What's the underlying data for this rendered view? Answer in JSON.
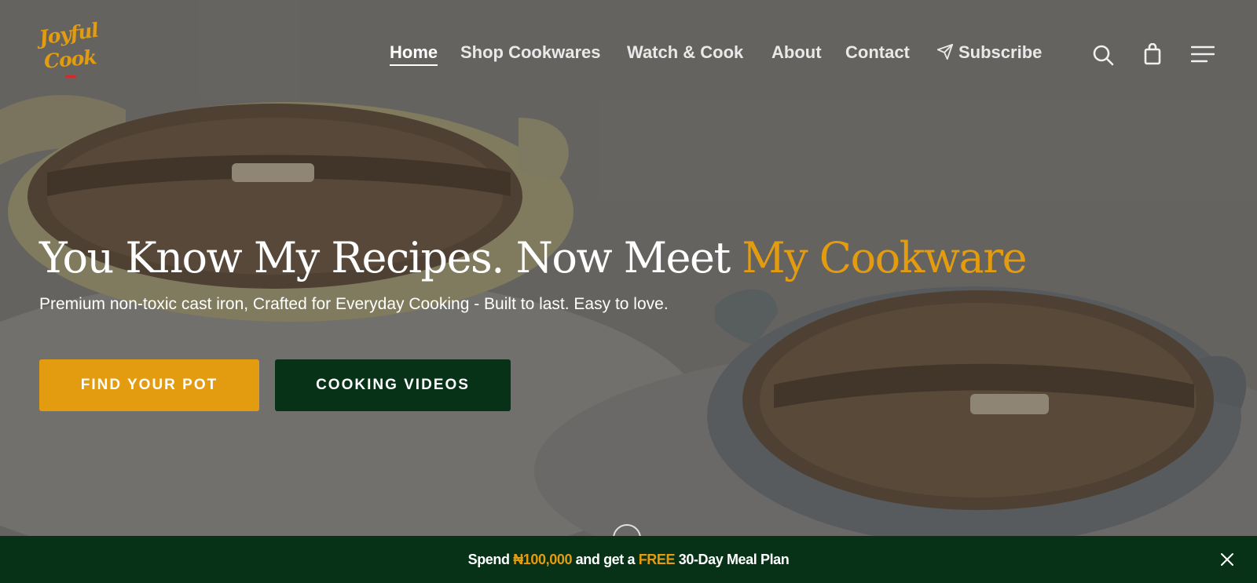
{
  "brand": {
    "logo_line1": "Joyful",
    "logo_line2": "Cook"
  },
  "nav": {
    "items": [
      {
        "label": "Home",
        "active": true
      },
      {
        "label": "Shop Cookwares"
      },
      {
        "label": "Watch & Cook"
      },
      {
        "label": "About"
      },
      {
        "label": "Contact"
      },
      {
        "label": "Subscribe",
        "icon": "paper-plane-icon"
      }
    ],
    "icons": [
      "search-icon",
      "shopping-bag-icon",
      "menu-icon"
    ]
  },
  "hero": {
    "headline_main": "You Know My Recipes. Now Meet ",
    "headline_accent": "My Cookware",
    "subheading": "Premium non-toxic cast iron, Crafted for Everyday Cooking - Built to last. Easy to love.",
    "primary_cta": "FIND YOUR POT",
    "secondary_cta": "COOKING VIDEOS"
  },
  "promo": {
    "prefix": "Spend ",
    "amount": "₦100,000",
    "middle": " and get a ",
    "free": "FREE",
    "suffix": " 30-Day Meal Plan"
  },
  "colors": {
    "accent": "#e39b10",
    "dark_green": "#073218",
    "text_light": "#ffffff"
  }
}
